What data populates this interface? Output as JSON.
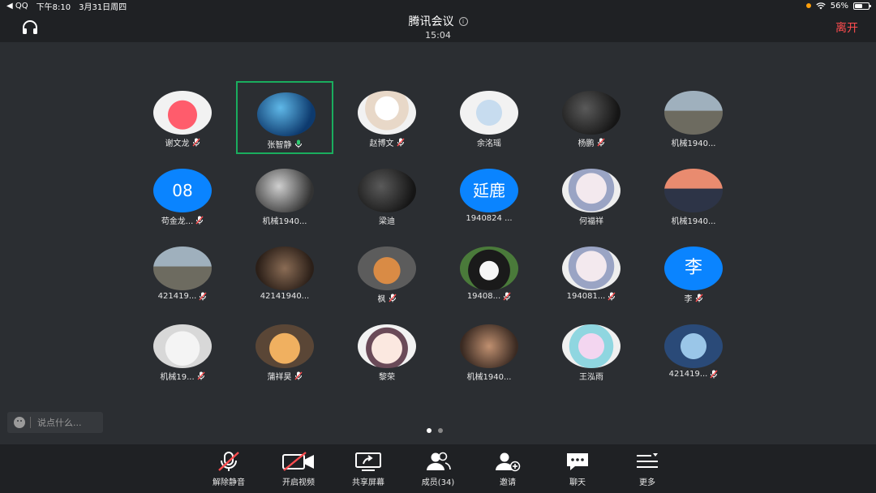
{
  "status": {
    "back_label": "◀ QQ",
    "time": "下午8:10",
    "date": "3月31日周四",
    "battery": "56%",
    "battery_level": 0.56
  },
  "header": {
    "title": "腾讯会议",
    "time": "15:04",
    "leave_label": "离开"
  },
  "participants": [
    {
      "name": "谢文龙",
      "muted": true,
      "avatar": "pink-pig"
    },
    {
      "name": "张智静",
      "muted": false,
      "avatar": "blue-globe",
      "active": true
    },
    {
      "name": "赵博文",
      "muted": true,
      "avatar": "anime-boy"
    },
    {
      "name": "余洺瑶",
      "muted": false,
      "avatar": "cartoon"
    },
    {
      "name": "杨鹏",
      "muted": true,
      "avatar": "photo-dark"
    },
    {
      "name": "机械1940...",
      "muted": false,
      "avatar": "road-photo"
    },
    {
      "name": "苟金龙...",
      "muted": true,
      "avatar": "letter",
      "letter": "08"
    },
    {
      "name": "机械1940...",
      "muted": false,
      "avatar": "bw-kids"
    },
    {
      "name": "梁迪",
      "muted": false,
      "avatar": "photo-dark"
    },
    {
      "name": "1940824 ...",
      "muted": false,
      "avatar": "letter",
      "letter": "延鹿"
    },
    {
      "name": "何福祥",
      "muted": false,
      "avatar": "anime-girl"
    },
    {
      "name": "机械1940...",
      "muted": false,
      "avatar": "sunset"
    },
    {
      "name": "421419...",
      "muted": true,
      "avatar": "road-photo"
    },
    {
      "name": "42141940...",
      "muted": false,
      "avatar": "meme"
    },
    {
      "name": "枫",
      "muted": true,
      "avatar": "shiba"
    },
    {
      "name": "19408...",
      "muted": true,
      "avatar": "dog-bw"
    },
    {
      "name": "194081...",
      "muted": true,
      "avatar": "anime-girl"
    },
    {
      "name": "李",
      "muted": true,
      "avatar": "letter",
      "letter": "李"
    },
    {
      "name": "机械19...",
      "muted": true,
      "avatar": "cat-white"
    },
    {
      "name": "蒲祥昊",
      "muted": true,
      "avatar": "corgi"
    },
    {
      "name": "黎荣",
      "muted": false,
      "avatar": "anime-chibi"
    },
    {
      "name": "机械1940...",
      "muted": false,
      "avatar": "photo-body"
    },
    {
      "name": "王泓雨",
      "muted": false,
      "avatar": "anime-color"
    },
    {
      "name": "421419...",
      "muted": true,
      "avatar": "anime-blue"
    }
  ],
  "chat": {
    "placeholder": "说点什么..."
  },
  "pages": {
    "current": 1,
    "total": 2
  },
  "toolbar": {
    "unmute_label": "解除静音",
    "video_label": "开启视频",
    "share_label": "共享屏幕",
    "members_label": "成员(34)",
    "invite_label": "邀请",
    "chat_label": "聊天",
    "more_label": "更多"
  },
  "colors": {
    "background": "#2b2e32",
    "bar": "#1f2124",
    "leave": "#ff4d4f",
    "active_border": "#1aad5e",
    "letter_avatar": "#0a84ff",
    "muted_icon": "#ff4d4f"
  }
}
